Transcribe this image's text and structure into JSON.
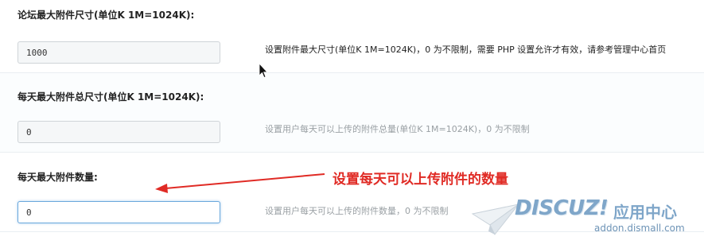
{
  "settings": {
    "rows": [
      {
        "label": "论坛最大附件尺寸(单位K 1M=1024K):",
        "value": "1000",
        "hint": "设置附件最大尺寸(单位K 1M=1024K)，0 为不限制，需要 PHP 设置允许才有效，请参考管理中心首页"
      },
      {
        "label": "每天最大附件总尺寸(单位K 1M=1024K):",
        "value": "0",
        "hint": "设置用户每天可以上传的附件总量(单位K 1M=1024K)，0 为不限制"
      },
      {
        "label": "每天最大附件数量:",
        "value": "0",
        "hint": "设置用户每天可以上传的附件数量，0 为不限制"
      }
    ]
  },
  "annotation": {
    "text": "设置每天可以上传附件的数量",
    "color": "#e02b25"
  },
  "watermark": {
    "brand": "DISCUZ!",
    "suffix": "应用中心",
    "domain": "addon.dismall.com",
    "color": "#7fa6c9"
  }
}
